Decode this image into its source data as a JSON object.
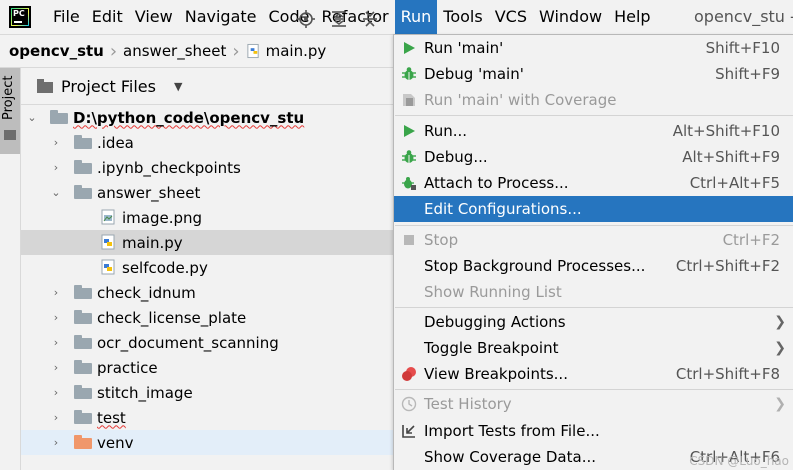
{
  "menubar": {
    "items": [
      "File",
      "Edit",
      "View",
      "Navigate",
      "Code",
      "Refactor",
      "Run",
      "Tools",
      "VCS",
      "Window",
      "Help"
    ],
    "active_item": "Run",
    "project_title": "opencv_stu - "
  },
  "breadcrumb": {
    "items": [
      "opencv_stu",
      "answer_sheet",
      "main.py"
    ]
  },
  "side_stripe": {
    "tab_label": "Project"
  },
  "project_panel": {
    "title": "Project Files",
    "toolbar": {
      "locate_icon": "crosshair-icon",
      "expand_icon": "expand-all-icon",
      "collapse_icon": "collapse-all-icon"
    }
  },
  "tree": {
    "root": "D:\\python_code\\opencv_stu",
    "rows": [
      {
        "label": ".idea",
        "type": "folder",
        "expanded": false
      },
      {
        "label": ".ipynb_checkpoints",
        "type": "folder",
        "expanded": false
      },
      {
        "label": "answer_sheet",
        "type": "folder",
        "expanded": true
      },
      {
        "label": "image.png",
        "type": "image-file"
      },
      {
        "label": "main.py",
        "type": "python-file",
        "selected": true
      },
      {
        "label": "selfcode.py",
        "type": "python-file"
      },
      {
        "label": "check_idnum",
        "type": "folder",
        "expanded": false
      },
      {
        "label": "check_license_plate",
        "type": "folder",
        "expanded": false
      },
      {
        "label": "ocr_document_scanning",
        "type": "folder",
        "expanded": false
      },
      {
        "label": "practice",
        "type": "folder",
        "expanded": false
      },
      {
        "label": "stitch_image",
        "type": "folder",
        "expanded": false
      },
      {
        "label": "test",
        "type": "folder",
        "expanded": false
      },
      {
        "label": "venv",
        "type": "venv-folder",
        "expanded": false
      }
    ]
  },
  "run_menu": {
    "items": [
      {
        "label": "Run 'main'",
        "shortcut": "Shift+F10",
        "icon": "run-icon"
      },
      {
        "label": "Debug 'main'",
        "shortcut": "Shift+F9",
        "icon": "debug-icon"
      },
      {
        "label": "Run 'main' with Coverage",
        "shortcut": "",
        "icon": "coverage-icon",
        "disabled": true
      },
      {
        "label": "Run...",
        "shortcut": "Alt+Shift+F10",
        "icon": "run-icon"
      },
      {
        "label": "Debug...",
        "shortcut": "Alt+Shift+F9",
        "icon": "debug-icon"
      },
      {
        "label": "Attach to Process...",
        "shortcut": "Ctrl+Alt+F5",
        "icon": "attach-icon"
      },
      {
        "label": "Edit Configurations...",
        "shortcut": "",
        "highlighted": true
      },
      {
        "label": "Stop",
        "shortcut": "Ctrl+F2",
        "icon": "stop-icon",
        "disabled": true
      },
      {
        "label": "Stop Background Processes...",
        "shortcut": "Ctrl+Shift+F2"
      },
      {
        "label": "Show Running List",
        "shortcut": "",
        "disabled": true
      },
      {
        "label": "Debugging Actions",
        "submenu": true
      },
      {
        "label": "Toggle Breakpoint",
        "submenu": true
      },
      {
        "label": "View Breakpoints...",
        "shortcut": "Ctrl+Shift+F8",
        "icon": "breakpoints-icon"
      },
      {
        "label": "Test History",
        "submenu": true,
        "icon": "history-icon",
        "disabled": true
      },
      {
        "label": "Import Tests from File...",
        "icon": "import-icon"
      },
      {
        "label": "Show Coverage Data...",
        "shortcut": "Ctrl+Alt+F6"
      }
    ]
  },
  "watermark": "CSDN @Luo_hao"
}
